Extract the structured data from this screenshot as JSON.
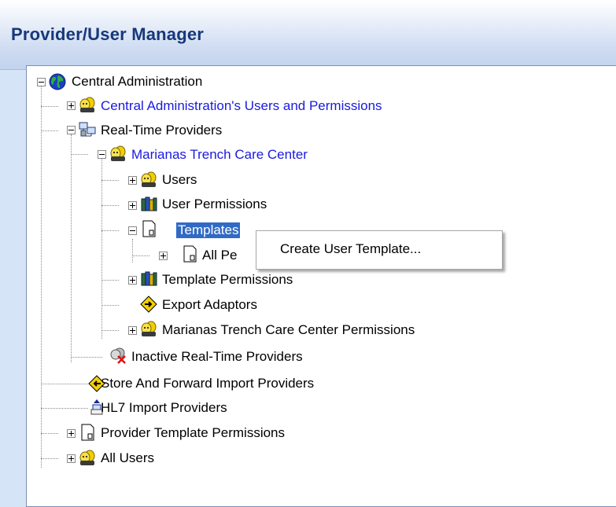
{
  "window": {
    "title": "Provider/User Manager"
  },
  "tree": {
    "root": "Central Administration",
    "ca_users": "Central Administration's Users and Permissions",
    "realtime": "Real-Time Providers",
    "marianas": "Marianas Trench Care Center",
    "users": "Users",
    "user_permissions": "User Permissions",
    "templates": "Templates",
    "all_pe": "All Pe",
    "template_permissions": "Template Permissions",
    "export_adaptors": "Export Adaptors",
    "mt_permissions": "Marianas Trench Care Center Permissions",
    "inactive": "Inactive Real-Time Providers",
    "store_forward": "Store And Forward Import Providers",
    "hl7": "HL7 Import Providers",
    "provider_template_permissions": "Provider Template Permissions",
    "all_users": "All Users"
  },
  "context_menu": {
    "item": "Create User Template..."
  },
  "colors": {
    "link": "#1a1ae0",
    "selection": "#316ac5",
    "title": "#16387a"
  }
}
